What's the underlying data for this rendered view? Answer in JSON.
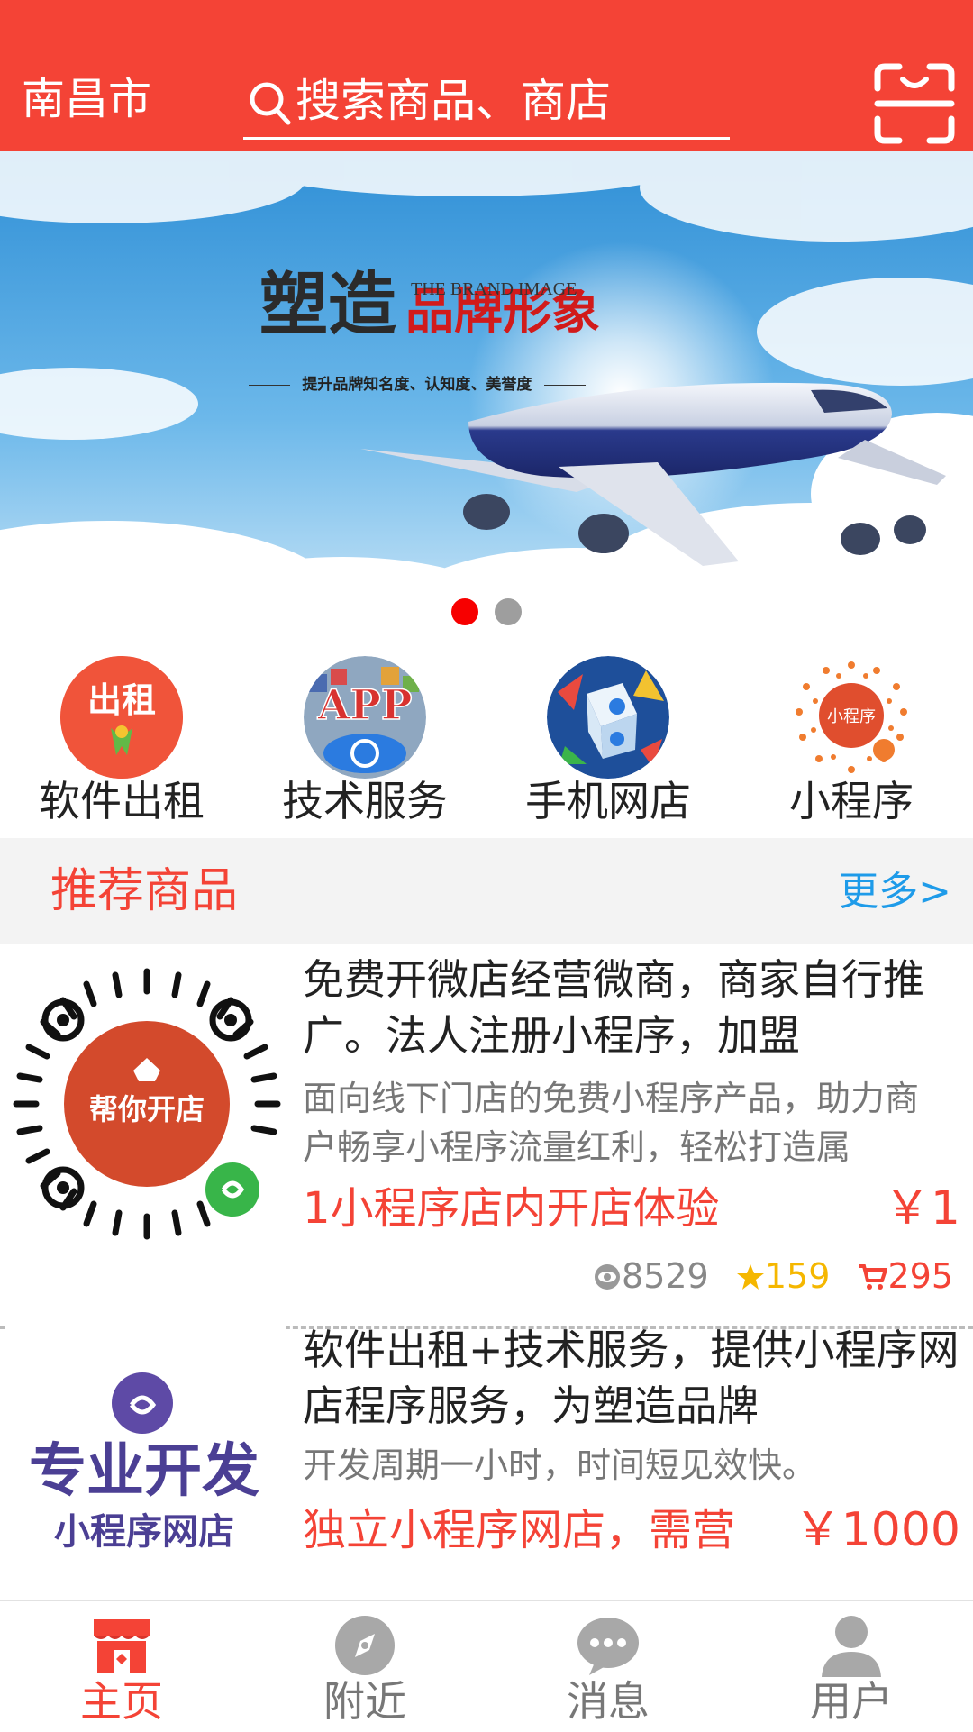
{
  "header": {
    "city": "南昌市",
    "search_placeholder": "搜索商品、商店",
    "search_icon": "search-icon",
    "scan_icon": "scan-icon",
    "background_color": "#f44336"
  },
  "banner": {
    "headline_black": "塑造",
    "headline_red": "品牌形象",
    "subtitle_en": "THE BRAND IMAGE",
    "tagline": "提升品牌知名度、认知度、美誉度",
    "slides_total": 2,
    "active_slide": 1
  },
  "categories": [
    {
      "label": "软件出租",
      "icon": "rental-icon",
      "icon_text": "出租"
    },
    {
      "label": "技术服务",
      "icon": "app-store-icon",
      "icon_text": "APP"
    },
    {
      "label": "手机网店",
      "icon": "mobile-shop-icon"
    },
    {
      "label": "小程序",
      "icon": "mini-program-icon",
      "icon_text": "小程序"
    }
  ],
  "recommended": {
    "title": "推荐商品",
    "more": "更多>"
  },
  "products": [
    {
      "title": "免费开微店经营微商，商家自行推广。法人注册小程序，加盟",
      "description": "面向线下门店的免费小程序产品，助力商户畅享小程序流量红利，轻松打造属",
      "subtitle": "1小程序店内开店体验",
      "price": "￥1",
      "thumb_text": "帮你开店",
      "views": "8529",
      "stars": "159",
      "cart": "295"
    },
    {
      "title": "软件出租+技术服务，提供小程序网店程序服务，为塑造品牌",
      "description": "开发周期一小时，时间短见效快。",
      "subtitle": "独立小程序网店，需营",
      "price": "￥1000",
      "thumb_text_1": "专业开发",
      "thumb_text_2": "小程序网店"
    }
  ],
  "bottom_nav": [
    {
      "label": "主页",
      "icon": "shop-icon",
      "active": true
    },
    {
      "label": "附近",
      "icon": "compass-icon",
      "active": false
    },
    {
      "label": "消息",
      "icon": "message-icon",
      "active": false
    },
    {
      "label": "用户",
      "icon": "user-icon",
      "active": false
    }
  ],
  "colors": {
    "accent": "#f44336",
    "link": "#1e9be9",
    "star": "#f5b700"
  }
}
